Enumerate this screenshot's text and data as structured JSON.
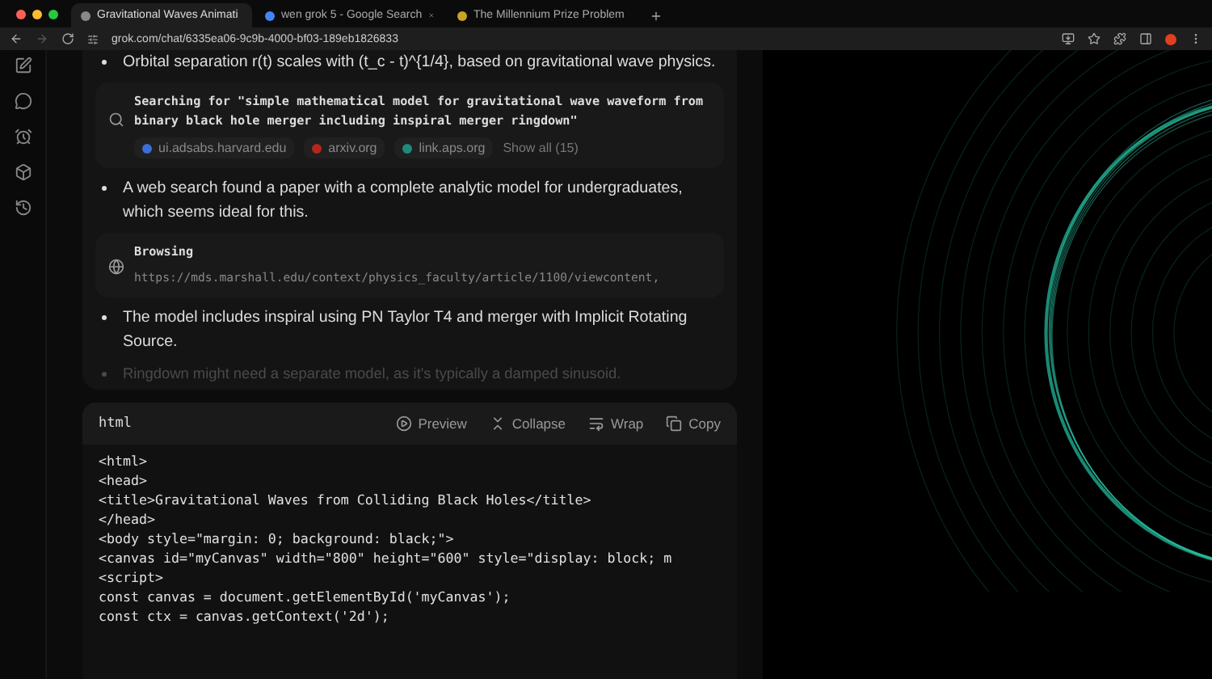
{
  "browser": {
    "tabs": [
      {
        "title": "Gravitational Waves Animati",
        "selected": true
      },
      {
        "title": "wen grok 5 - Google Search",
        "selected": false
      },
      {
        "title": "The Millennium Prize Problem",
        "selected": false
      }
    ],
    "address": "grok.com/chat/6335ea06-9c9b-4000-bf03-189eb1826833"
  },
  "thinking": [
    {
      "kind": "bullet",
      "text": "Orbital separation r(t) scales with (t_c - t)^{1/4}, based on gravitational wave physics."
    },
    {
      "kind": "search",
      "title": "Searching for \"simple mathematical model for gravitational wave waveform from binary black hole merger including inspiral merger ringdown\"",
      "sources": [
        {
          "label": "ui.adsabs.harvard.edu",
          "color": "#3b6fd8"
        },
        {
          "label": "arxiv.org",
          "color": "#b3261e"
        },
        {
          "label": "link.aps.org",
          "color": "#1f8a7a"
        }
      ],
      "show_all": "Show all (15)"
    },
    {
      "kind": "bullet",
      "text": "A web search found a paper with a complete analytic model for undergraduates, which seems ideal for this."
    },
    {
      "kind": "browse",
      "title": "Browsing",
      "url": "https://mds.marshall.edu/context/physics_faculty/article/1100/viewcontent,"
    },
    {
      "kind": "bullet",
      "text": "The model includes inspiral using PN Taylor T4 and merger with Implicit Rotating Source."
    },
    {
      "kind": "faded",
      "text": "Ringdown might need a separate model, as it's typically a damped sinusoid."
    }
  ],
  "code_block": {
    "language": "html",
    "actions": [
      {
        "kind": "preview",
        "label": "Preview"
      },
      {
        "kind": "collapse",
        "label": "Collapse"
      },
      {
        "kind": "wrap",
        "label": "Wrap"
      },
      {
        "kind": "copy",
        "label": "Copy"
      }
    ],
    "lines": [
      "<html>",
      "<head>",
      "<title>Gravitational Waves from Colliding Black Holes</title>",
      "</head>",
      "<body style=\"margin: 0; background: black;\">",
      "<canvas id=\"myCanvas\" width=\"800\" height=\"600\" style=\"display: block; m",
      "<script>",
      "const canvas = document.getElementById('myCanvas');",
      "const ctx = canvas.getContext('2d');"
    ]
  }
}
